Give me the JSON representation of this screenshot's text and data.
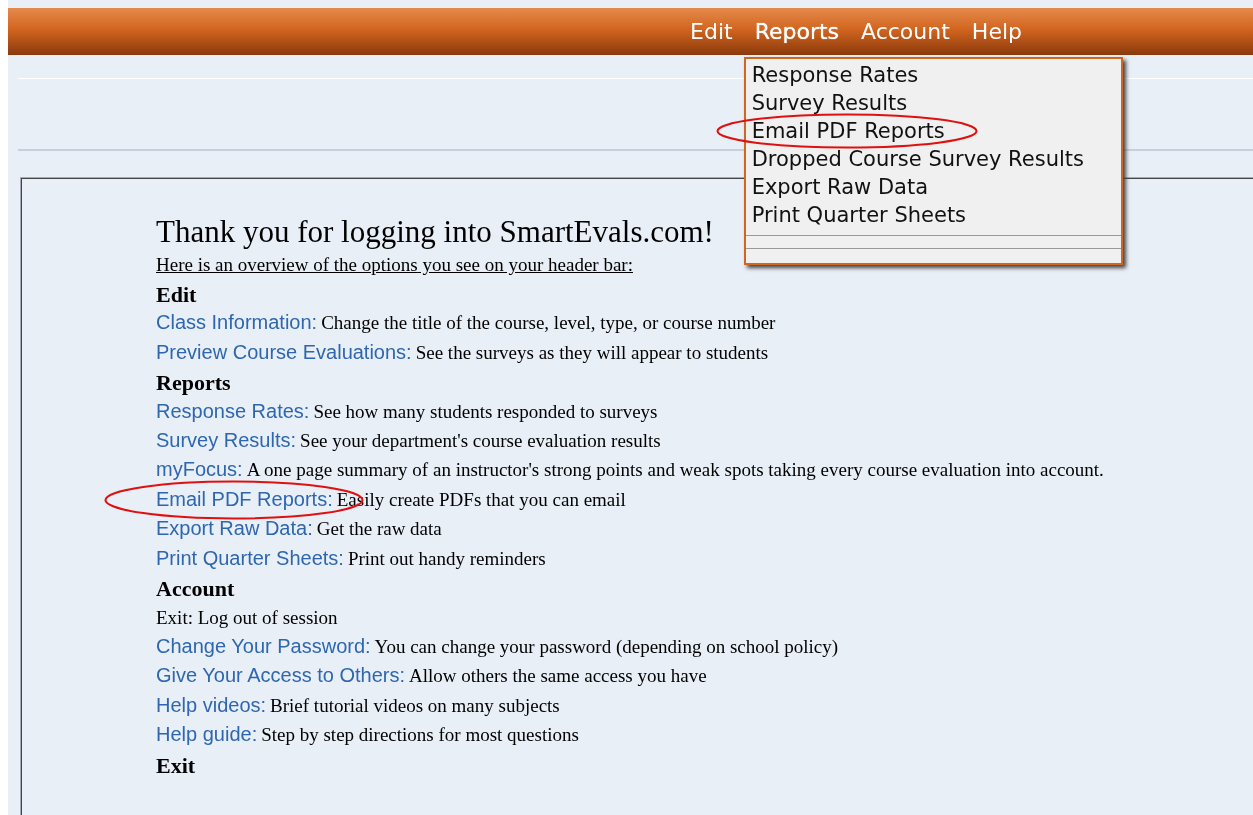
{
  "menu": [
    {
      "label": "Edit",
      "open": false
    },
    {
      "label": "Reports",
      "open": true,
      "dropdown": [
        {
          "label": "Response Rates",
          "circled": false
        },
        {
          "label": "Survey Results",
          "circled": false
        },
        {
          "label": "Email PDF Reports",
          "circled": true
        },
        {
          "label": "Dropped Course Survey Results",
          "circled": false
        },
        {
          "label": "Export Raw Data",
          "circled": false
        },
        {
          "label": "Print Quarter Sheets",
          "circled": false
        }
      ]
    },
    {
      "label": "Account",
      "open": false
    },
    {
      "label": "Help",
      "open": false
    }
  ],
  "content": {
    "title": "Thank you for logging into SmartEvals.com!",
    "subtitle": "Here is an overview of the options you see on your header bar:",
    "lines": [
      {
        "kind": "heading",
        "text": "Edit"
      },
      {
        "kind": "link",
        "link": "Class Information:",
        "text": "Change the title of the course, level, type, or course number",
        "circled": false
      },
      {
        "kind": "link",
        "link": "Preview Course Evaluations:",
        "text": "See the surveys as they will appear to students",
        "circled": false
      },
      {
        "kind": "heading",
        "text": "Reports"
      },
      {
        "kind": "link",
        "link": "Response Rates:",
        "text": "See how many students responded to surveys",
        "circled": false
      },
      {
        "kind": "link",
        "link": "Survey Results:",
        "text": "See your department's course evaluation results",
        "circled": false
      },
      {
        "kind": "link",
        "link": "myFocus:",
        "text": "A one page summary of an instructor's strong points and weak spots taking every course evaluation into account.",
        "circled": false
      },
      {
        "kind": "link",
        "link": "Email PDF Reports:",
        "text": "Easily create PDFs that you can email",
        "circled": true
      },
      {
        "kind": "link",
        "link": "Export Raw Data:",
        "text": "Get the raw data",
        "circled": false
      },
      {
        "kind": "link",
        "link": "Print Quarter Sheets:",
        "text": "Print out handy reminders",
        "circled": false
      },
      {
        "kind": "heading",
        "text": "Account"
      },
      {
        "kind": "plain",
        "text": "Exit: Log out of session"
      },
      {
        "kind": "link",
        "link": "Change Your Password:",
        "text": "You can change your password (depending on school policy)",
        "circled": false
      },
      {
        "kind": "link",
        "link": "Give Your Access to Others:",
        "text": "Allow others the same access you have",
        "circled": false
      },
      {
        "kind": "link",
        "link": "Help videos:",
        "text": "Brief tutorial videos on many subjects",
        "circled": false
      },
      {
        "kind": "link",
        "link": "Help guide:",
        "text": "Step by step directions for most questions",
        "circled": false
      },
      {
        "kind": "heading",
        "text": "Exit"
      }
    ]
  }
}
